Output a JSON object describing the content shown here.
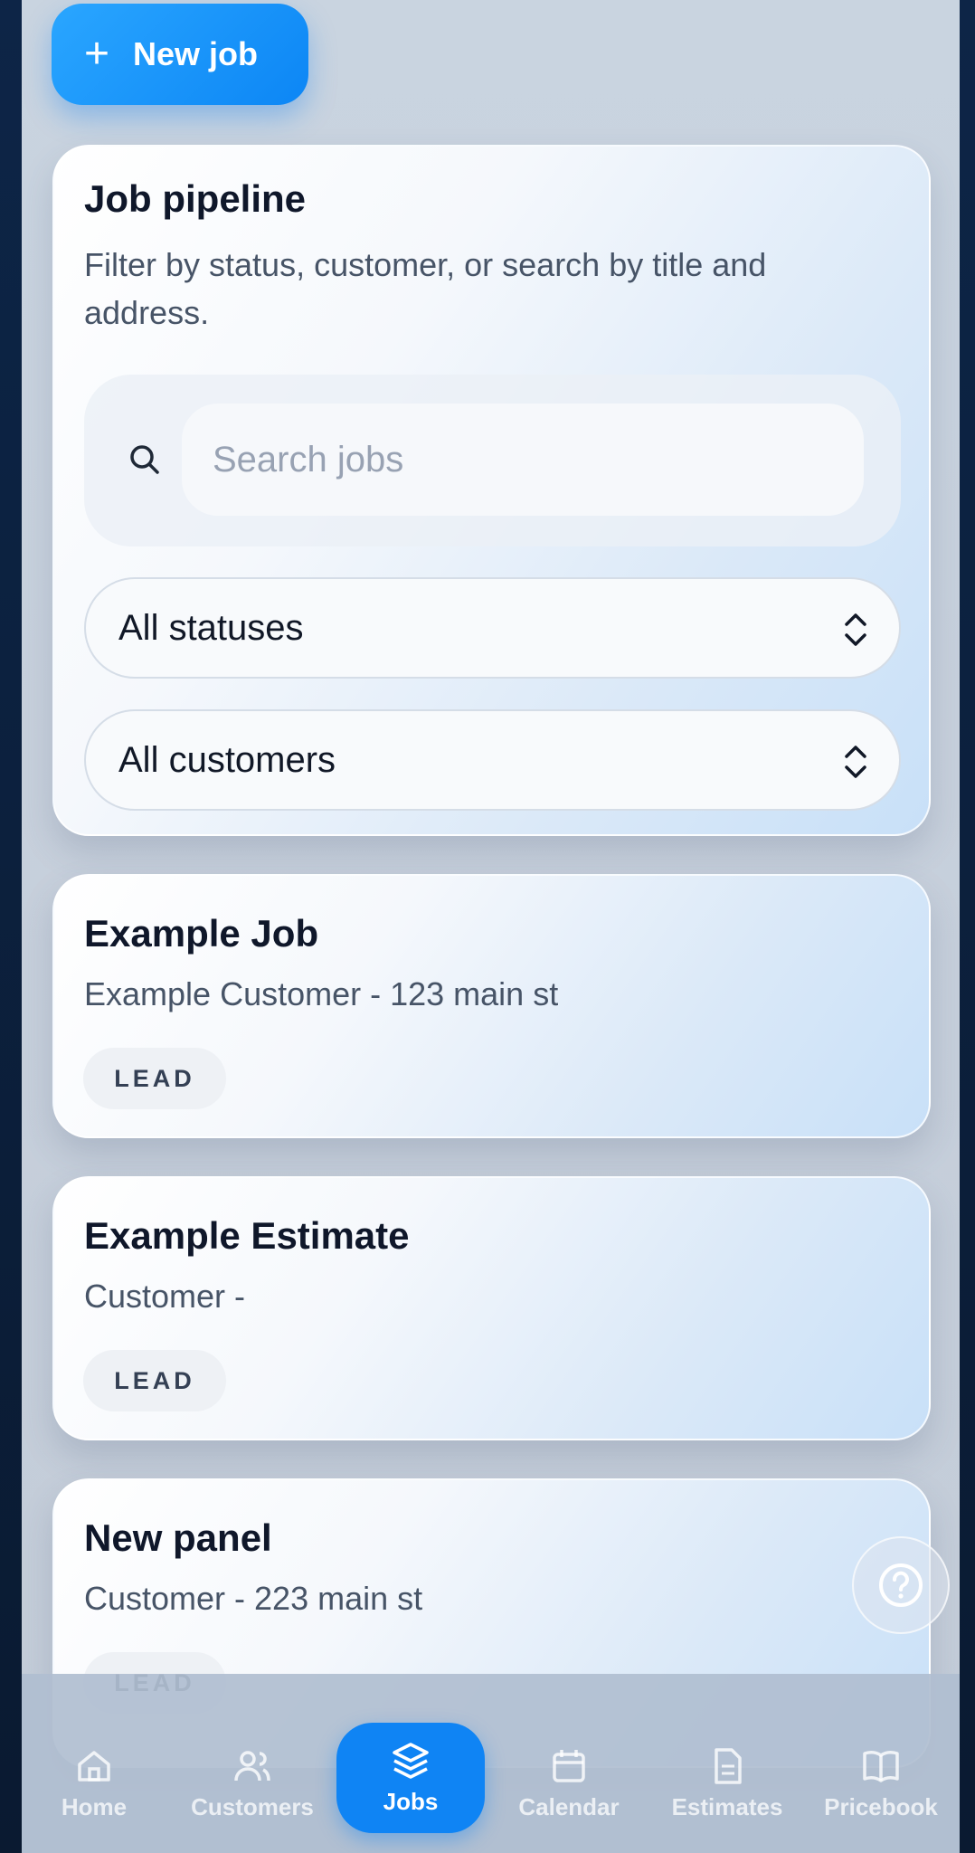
{
  "header": {
    "new_job_label": "New job"
  },
  "pipeline": {
    "title": "Job pipeline",
    "subtitle": "Filter by status, customer, or search by title and address.",
    "search_placeholder": "Search jobs",
    "status_filter": "All statuses",
    "customer_filter": "All customers"
  },
  "jobs": [
    {
      "title": "Example Job",
      "meta": "Example Customer - 123 main st",
      "status": "LEAD"
    },
    {
      "title": "Example Estimate",
      "meta": "Customer -",
      "status": "LEAD"
    },
    {
      "title": "New panel",
      "meta": "Customer - 223 main st",
      "status": "LEAD"
    }
  ],
  "tabs": [
    {
      "label": "Home",
      "icon": "home-icon"
    },
    {
      "label": "Customers",
      "icon": "users-icon"
    },
    {
      "label": "Jobs",
      "icon": "layers-icon",
      "active": true
    },
    {
      "label": "Calendar",
      "icon": "calendar-icon"
    },
    {
      "label": "Estimates",
      "icon": "document-icon"
    },
    {
      "label": "Pricebook",
      "icon": "book-icon"
    }
  ],
  "colors": {
    "accent": "#0f84f4",
    "text": "#0f172a",
    "muted": "#475467"
  }
}
